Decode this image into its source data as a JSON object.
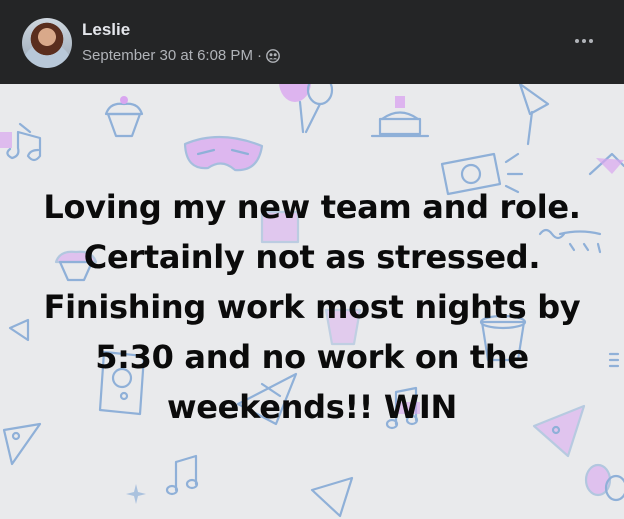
{
  "post": {
    "author": "Leslie",
    "timestamp": "September 30 at 6:08 PM",
    "separator": "·",
    "privacy_icon": "friends-icon",
    "more_icon": "more-options-icon",
    "text": "Loving my new team and role. Certainly not as stressed. Finishing work most nights by 5:30 and no work on the weekends!! WIN",
    "background": {
      "base_color": "#e9eaec",
      "doodle_color": "#8fb0d8",
      "accent_color": "#d9a6f0",
      "pattern": "party doodles"
    }
  },
  "colors": {
    "header_bg": "#242526",
    "name_text": "#e4e6eb",
    "meta_text": "#b0b3b8"
  }
}
